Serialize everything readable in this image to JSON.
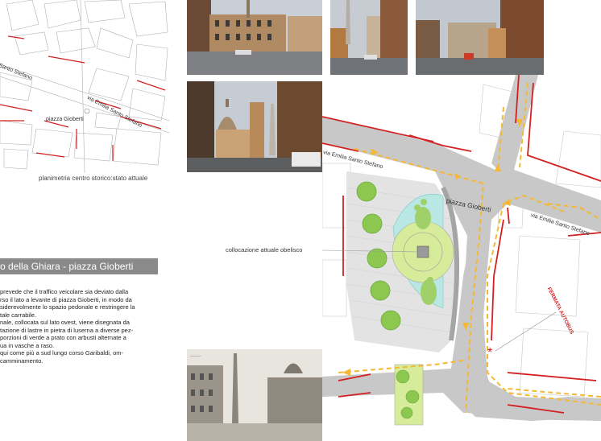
{
  "map_labels": {
    "street_left": "via Emilia Santo Stefano",
    "street_left_top": "Santo Stefano",
    "square_left": "piazza Gioberti",
    "caption": "planimetria centro storico:stato attuale"
  },
  "section_title": "o della Ghiara - piazza Gioberti",
  "body_lines": [
    "prevede che il traffico veicolare sia deviato dalla",
    "rso il lato a levante di piazza Gioberti, in modo da",
    "siderevolmente lo spazio pedonale e restringere la",
    "tale carrabile.",
    "nale, collocata sul lato ovest, viene disegnata da",
    "tazione di lastre in pietra di luserna a diverse pez-",
    "porzioni di verde a  prato con arbusti alternate a",
    "ua in vasche a raso.",
    "qui come più a sud lungo corso Garibaldi, om-",
    "camminamento."
  ],
  "plan_labels": {
    "obelisk_note": "collocazione attuale obelisco",
    "street_nw": "via Emilia Santo Stefano",
    "square": "piazza Gioberti",
    "street_e": "via Emilia Santo Stefano",
    "bus_stop": "FERMATA AUTOBUS"
  },
  "colors": {
    "road": "#c8c8c8",
    "arrow": "#f5b835",
    "edge": "#d42020",
    "green": "#9fd06a",
    "water": "#b9e7e4",
    "tree": "#8cc850"
  }
}
